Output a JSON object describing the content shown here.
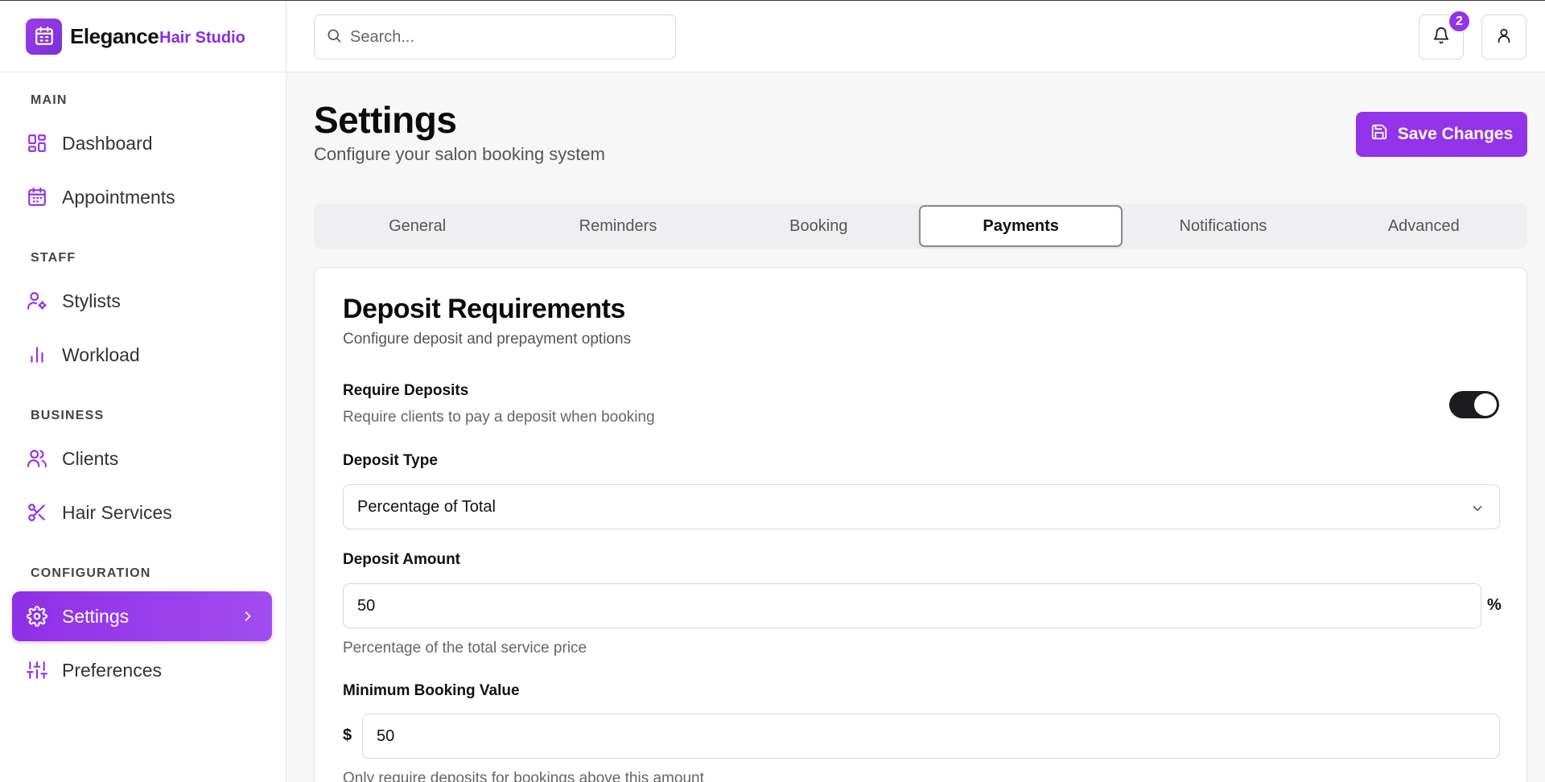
{
  "app": {
    "brand_name": "Elegance",
    "brand_sub": "Hair Studio"
  },
  "sidebar": {
    "sections": [
      {
        "title": "MAIN"
      },
      {
        "title": "STAFF"
      },
      {
        "title": "BUSINESS"
      },
      {
        "title": "CONFIGURATION"
      }
    ],
    "items": [
      {
        "label": "Dashboard",
        "icon": "dashboard-grid-icon"
      },
      {
        "label": "Appointments",
        "icon": "calendar-icon"
      },
      {
        "label": "Stylists",
        "icon": "user-cog-icon"
      },
      {
        "label": "Workload",
        "icon": "bar-chart-icon"
      },
      {
        "label": "Clients",
        "icon": "users-icon"
      },
      {
        "label": "Hair Services",
        "icon": "scissors-icon"
      },
      {
        "label": "Settings",
        "icon": "gear-icon",
        "active": true
      },
      {
        "label": "Preferences",
        "icon": "sliders-icon"
      }
    ]
  },
  "header": {
    "search_placeholder": "Search...",
    "notifications_count": "2"
  },
  "page": {
    "title": "Settings",
    "subtitle": "Configure your salon booking system",
    "save_label": "Save Changes"
  },
  "tabs": [
    {
      "label": "General"
    },
    {
      "label": "Reminders"
    },
    {
      "label": "Booking"
    },
    {
      "label": "Payments",
      "active": true
    },
    {
      "label": "Notifications"
    },
    {
      "label": "Advanced"
    }
  ],
  "card": {
    "title": "Deposit Requirements",
    "subtitle": "Configure deposit and prepayment options",
    "require_deposits": {
      "label": "Require Deposits",
      "help": "Require clients to pay a deposit when booking",
      "enabled": true
    },
    "deposit_type": {
      "label": "Deposit Type",
      "value": "Percentage of Total"
    },
    "deposit_amount": {
      "label": "Deposit Amount",
      "value": "50",
      "suffix": "%",
      "help": "Percentage of the total service price"
    },
    "min_booking": {
      "label": "Minimum Booking Value",
      "prefix": "$",
      "value": "50",
      "help": "Only require deposits for bookings above this amount"
    }
  },
  "colors": {
    "accent": "#9333ea",
    "toggle_on": "#1c1c1f"
  }
}
